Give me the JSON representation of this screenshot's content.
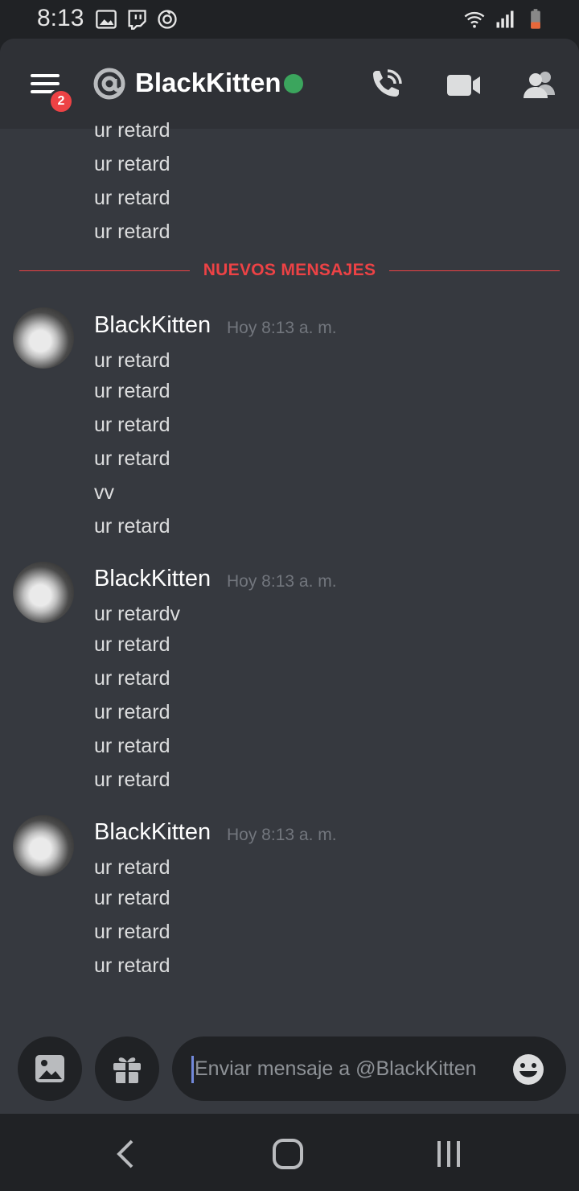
{
  "status_bar": {
    "time": "8:13",
    "icons_left": [
      "image-icon",
      "twitch-icon",
      "sync-icon"
    ],
    "icons_right": [
      "wifi-icon",
      "signal-icon",
      "battery-icon"
    ]
  },
  "header": {
    "unread_badge": "2",
    "prefix_icon": "at-icon",
    "title": "BlackKitten",
    "status": "online",
    "status_color": "#3ba55d",
    "actions": [
      "call-icon",
      "video-icon",
      "members-icon"
    ]
  },
  "earlier_lines": [
    "ur retard",
    "ur retard",
    "ur retard",
    "ur retard"
  ],
  "divider": {
    "label": "NUEVOS MENSAJES",
    "color": "#ed4245"
  },
  "groups": [
    {
      "author": "BlackKitten",
      "timestamp": "Hoy 8:13 a. m.",
      "lines": [
        "ur retard",
        "ur retard",
        "ur retard",
        "ur retard",
        "vv",
        "ur retard"
      ]
    },
    {
      "author": "BlackKitten",
      "timestamp": "Hoy 8:13 a. m.",
      "lines": [
        "ur retardv",
        "ur retard",
        "ur retard",
        "ur retard",
        "ur retard",
        "ur retard"
      ]
    },
    {
      "author": "BlackKitten",
      "timestamp": "Hoy 8:13 a. m.",
      "lines": [
        "ur retard",
        "ur retard",
        "ur retard",
        "ur retard"
      ]
    }
  ],
  "composer": {
    "placeholder": "Enviar mensaje a @BlackKitten",
    "buttons": [
      "image-upload-icon",
      "gift-icon",
      "emoji-icon"
    ]
  },
  "nav": [
    "back-icon",
    "home-icon",
    "recents-icon"
  ],
  "colors": {
    "background": "#36393f",
    "header": "#2f3136",
    "dark": "#202225",
    "text": "#dcddde",
    "muted": "#72767d",
    "accent": "#7289da"
  }
}
